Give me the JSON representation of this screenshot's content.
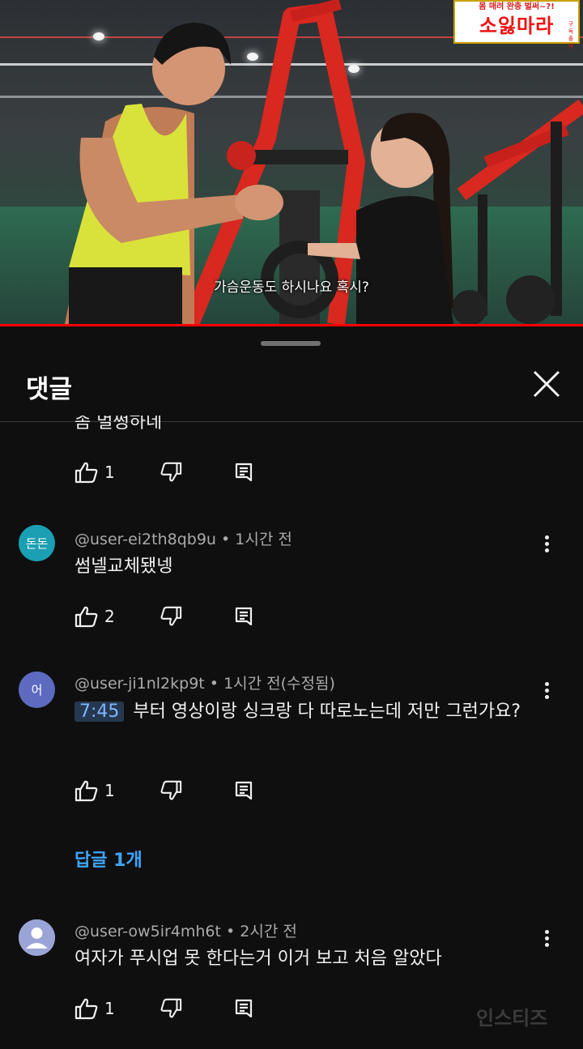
{
  "video": {
    "subtitle": "가슴운동도 하시나요 혹시?",
    "logo_top": "몸 매려 완충 벌써~?!",
    "logo_main": "소잃마라",
    "logo_side": "구독 좋아",
    "progress": 1.0
  },
  "sheet": {
    "title": "댓글",
    "truncated_text": "좀 멀쩡하네"
  },
  "comments": [
    {
      "like_count": "1"
    },
    {
      "avatar_text": "돈돈",
      "avatar_color": "#1b9fb3",
      "author": "@user-ei2th8qb9u",
      "time": "1시간 전",
      "text": "썸넬교체됐넹",
      "like_count": "2"
    },
    {
      "avatar_text": "어",
      "avatar_color": "#5c6bc0",
      "author": "@user-ji1nl2kp9t",
      "time": "1시간 전(수정됨)",
      "timestamp": "7:45",
      "text": "부터 영상이랑 싱크랑 다 따로노는데 저만 그런가요?",
      "like_count": "1",
      "replies_label": "답글 1개"
    },
    {
      "avatar_text": "",
      "avatar_color": "#9aa4d6",
      "author": "@user-ow5ir4mh6t",
      "time": "2시간 전",
      "text": "여자가 푸시업 못 한다는거 이거 보고 처음 알았다",
      "like_count": "1"
    }
  ],
  "watermark": "인스티즈",
  "icons": [
    "thumb-up-icon",
    "thumb-down-icon",
    "reply-icon",
    "more-vert-icon",
    "close-icon"
  ]
}
